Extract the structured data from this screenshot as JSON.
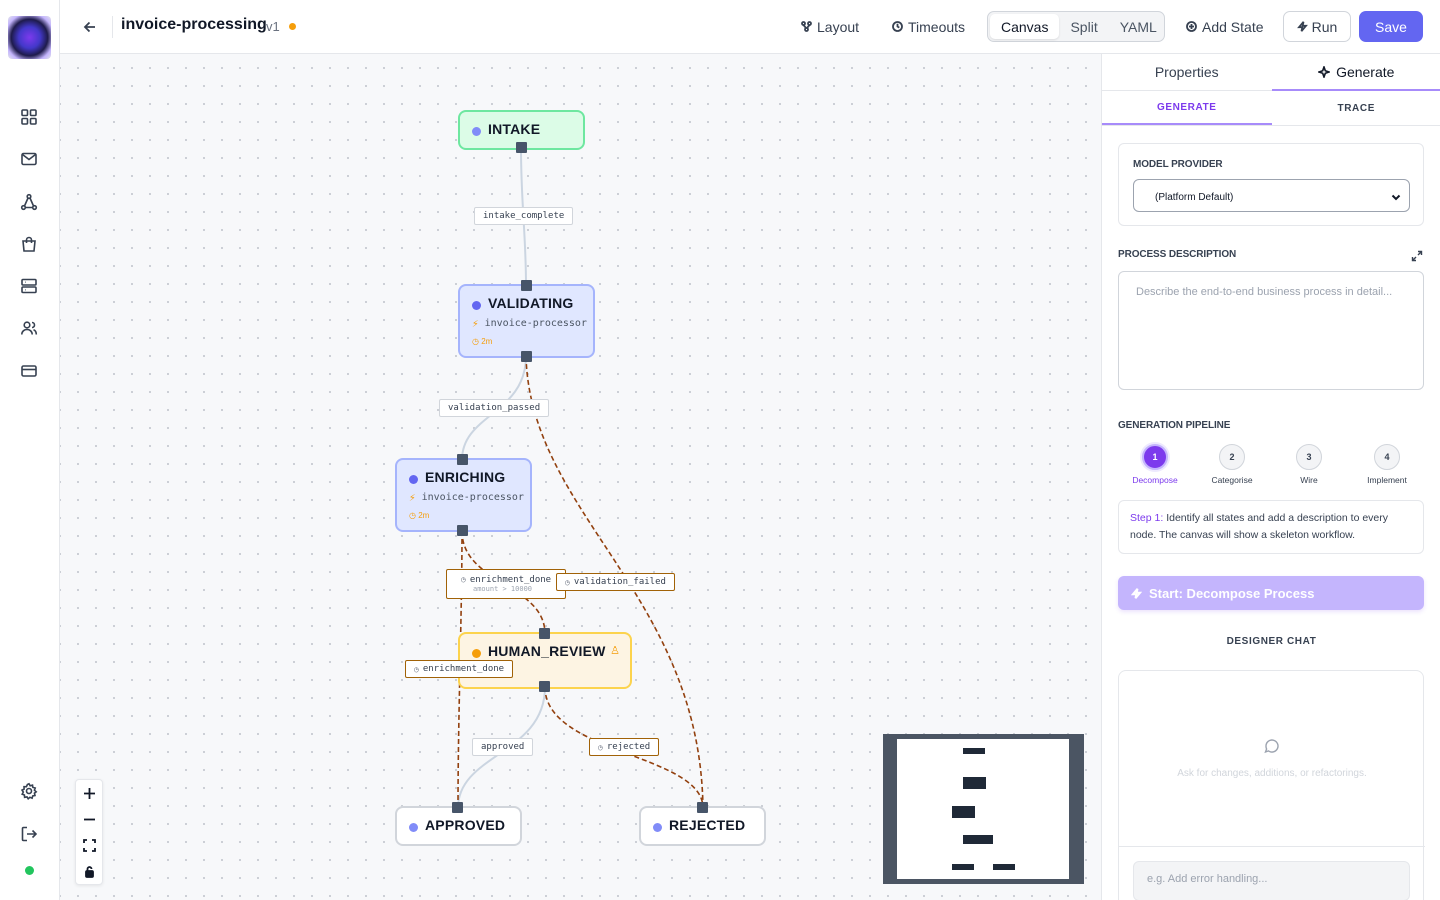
{
  "rail": {
    "items": [
      {
        "icon": "grid-icon"
      },
      {
        "icon": "mail-icon"
      },
      {
        "icon": "workflow-icon"
      },
      {
        "icon": "bag-icon"
      },
      {
        "icon": "server-icon"
      },
      {
        "icon": "users-icon"
      },
      {
        "icon": "card-icon"
      }
    ],
    "bottom": [
      {
        "icon": "settings-icon"
      },
      {
        "icon": "logout-icon"
      }
    ],
    "status_color": "#22c55e"
  },
  "header": {
    "name": "invoice-processing",
    "version": "v1",
    "unsaved_color": "#f59e0b",
    "layout_label": "Layout",
    "timeouts_label": "Timeouts",
    "views": [
      "Canvas",
      "Split",
      "YAML"
    ],
    "active_view": "Canvas",
    "add_state_label": "Add State",
    "run_label": "Run",
    "save_label": "Save"
  },
  "canvas": {
    "states": [
      {
        "id": "intake",
        "name": "INTAKE",
        "kind": "start",
        "agent": "",
        "timeout": ""
      },
      {
        "id": "validating",
        "name": "VALIDATING",
        "kind": "agent",
        "agent": "invoice-processor",
        "timeout": "2m"
      },
      {
        "id": "enriching",
        "name": "ENRICHING",
        "kind": "agent",
        "agent": "invoice-processor",
        "timeout": "2m"
      },
      {
        "id": "human_review",
        "name": "HUMAN_REVIEW",
        "kind": "human",
        "agent": "",
        "timeout": ""
      },
      {
        "id": "approved",
        "name": "APPROVED",
        "kind": "terminal",
        "agent": "",
        "timeout": ""
      },
      {
        "id": "rejected",
        "name": "REJECTED",
        "kind": "terminal",
        "agent": "",
        "timeout": ""
      }
    ],
    "transitions": [
      {
        "label": "intake_complete",
        "condition": "",
        "timed": false
      },
      {
        "label": "validation_passed",
        "condition": "",
        "timed": false
      },
      {
        "label": "enrichment_done",
        "condition": "amount > 10000",
        "timed": true
      },
      {
        "label": "validation_failed",
        "condition": "",
        "timed": true
      },
      {
        "label": "enrichment_done",
        "condition": "",
        "timed": true
      },
      {
        "label": "approved",
        "condition": "",
        "timed": false
      },
      {
        "label": "rejected",
        "condition": "",
        "timed": true
      }
    ],
    "colors": {
      "start_border": "#6ee7a0",
      "start_fill": "#dcfce7",
      "agent_border": "#a5b4fc",
      "agent_fill": "#e0e7ff",
      "human_border": "#fcd34d",
      "human_fill": "#fdf4e3",
      "terminal_border": "#d1d5db",
      "dot": "#818cf8",
      "human_dot": "#f59e0b",
      "timed_edge": "#92400e"
    }
  },
  "panel": {
    "tabs": [
      "Properties",
      "Generate"
    ],
    "active_tab": "Generate",
    "subtabs": [
      "GENERATE",
      "TRACE"
    ],
    "active_subtab": "GENERATE",
    "model_provider_label": "MODEL PROVIDER",
    "model_provider_value": "(Platform Default)",
    "process_description_label": "PROCESS DESCRIPTION",
    "process_description_placeholder": "Describe the end-to-end business process in detail...",
    "pipeline_label": "GENERATION PIPELINE",
    "steps": [
      {
        "number": "1",
        "label": "Decompose"
      },
      {
        "number": "2",
        "label": "Categorise"
      },
      {
        "number": "3",
        "label": "Wire"
      },
      {
        "number": "4",
        "label": "Implement"
      }
    ],
    "active_step": "1",
    "step_prefix": "Step 1:",
    "step_description": " Identify all states and add a description to every node. The canvas will show a skeleton workflow.",
    "start_button_label": "Start: Decompose Process",
    "chat_title": "DESIGNER CHAT",
    "chat_empty_text": "Ask for changes, additions, or refactorings.",
    "chat_placeholder": "e.g. Add error handling..."
  }
}
